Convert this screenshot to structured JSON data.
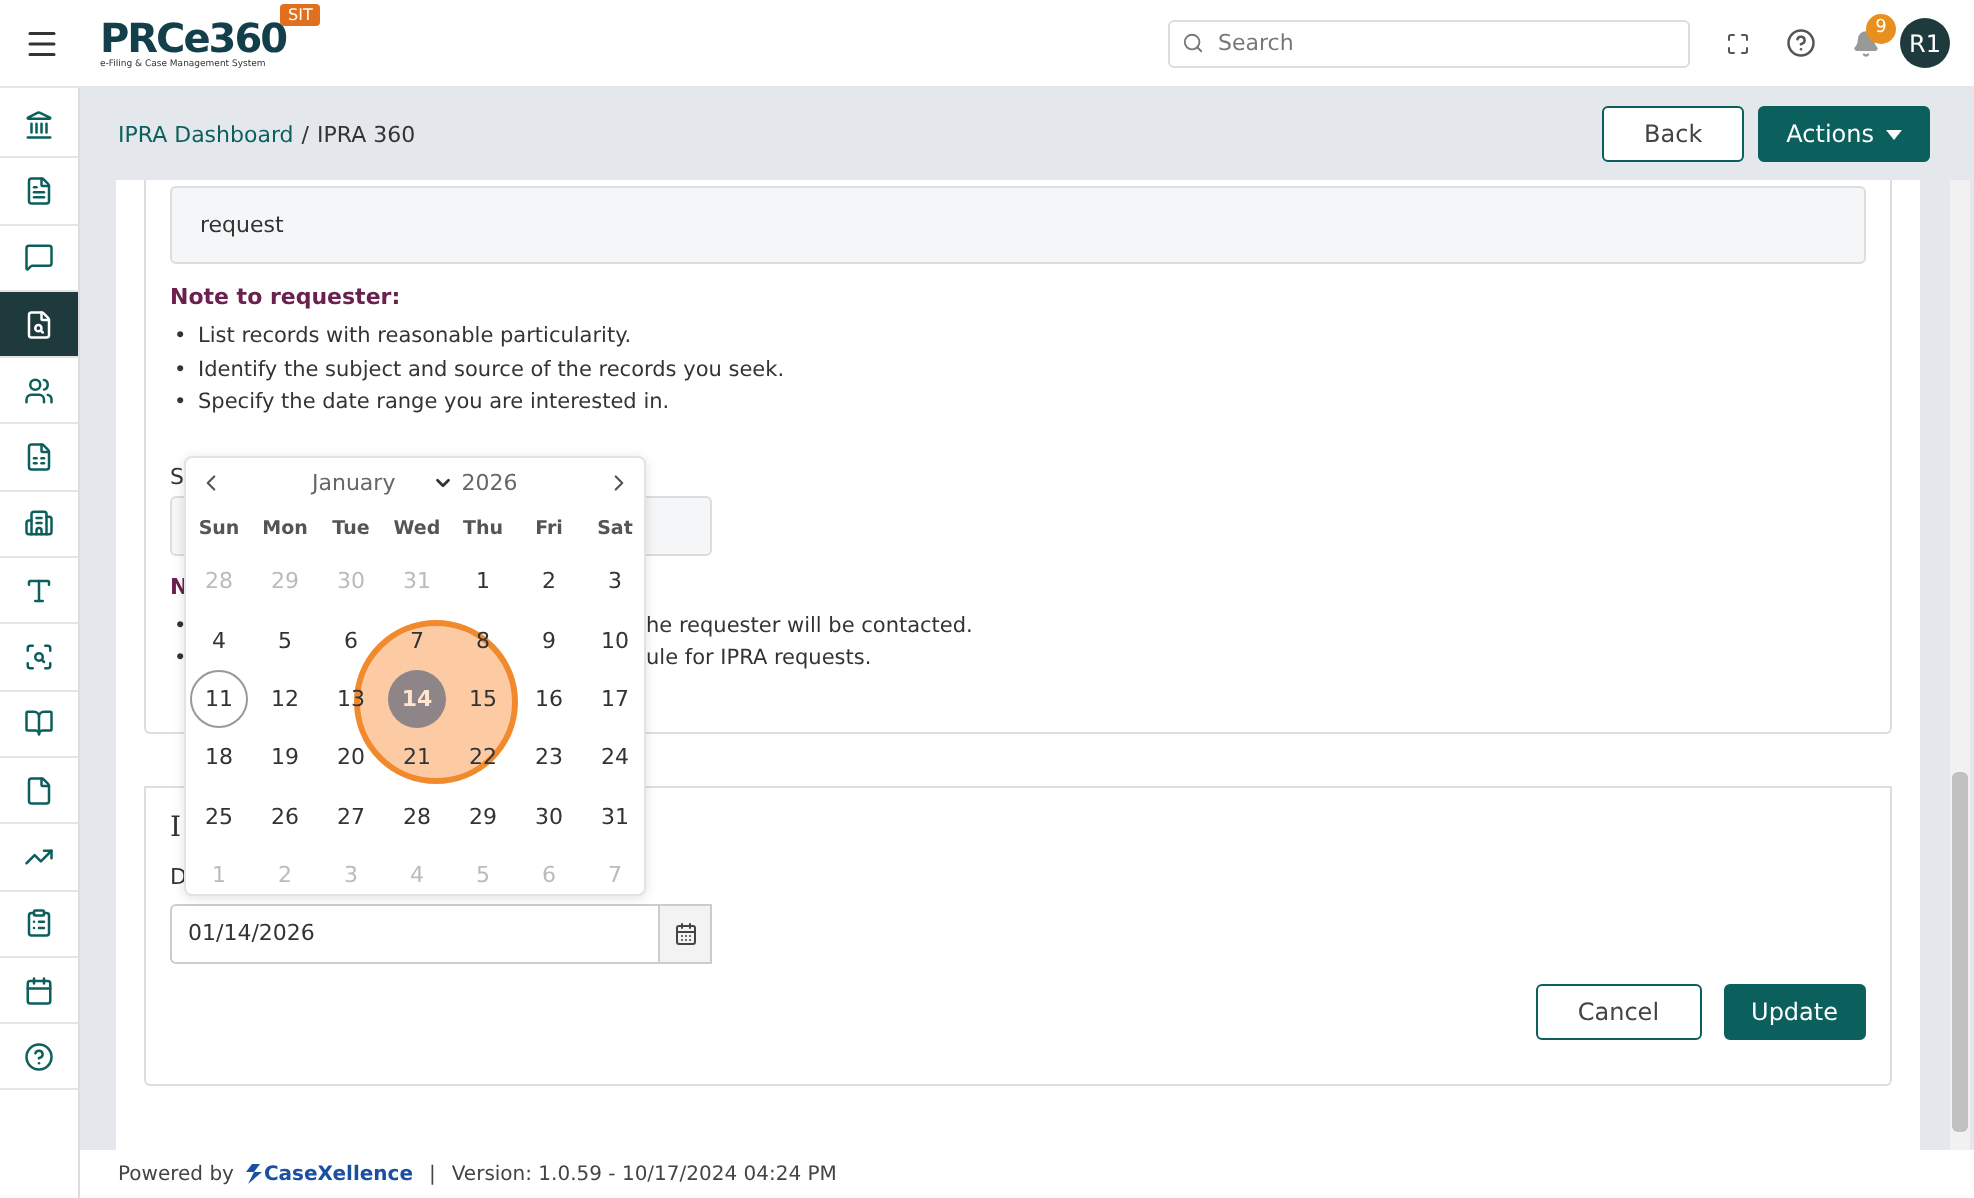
{
  "topbar": {
    "logo": "PRCe360",
    "logo_tagline": "e-Filing & Case Management System",
    "env_badge": "SIT",
    "search": {
      "placeholder": "Search"
    },
    "notification_count": "9",
    "avatar": "R1"
  },
  "sidebar": {
    "items": [
      {
        "selected": false
      },
      {
        "selected": false
      },
      {
        "selected": false
      },
      {
        "selected": true
      },
      {
        "selected": false
      },
      {
        "selected": false
      },
      {
        "selected": false
      },
      {
        "selected": false
      },
      {
        "selected": false
      },
      {
        "selected": false
      },
      {
        "selected": false
      },
      {
        "selected": false
      },
      {
        "selected": false
      },
      {
        "selected": false
      },
      {
        "selected": false
      }
    ]
  },
  "header": {
    "breadcrumb": [
      {
        "label": "IPRA Dashboard",
        "link": true
      },
      {
        "label": "/",
        "link": false
      },
      {
        "label": "IPRA 360",
        "link": false
      }
    ],
    "buttons": [
      {
        "label": "Back",
        "kind": "outline"
      },
      {
        "label": "Actions",
        "kind": "dropdown"
      }
    ]
  },
  "request_card": {
    "request_value": "request",
    "note_heading": "Note to requester:",
    "notes": [
      {
        "marker": "•",
        "text": "List records with reasonable particularity."
      },
      {
        "marker": "•",
        "text": "Identify the subject and source of the records you seek."
      },
      {
        "marker": "•",
        "text": "Specify the date range you are interested in."
      }
    ],
    "covered_label": "S",
    "covered_heading": "N",
    "covered_notes": [
      {
        "marker": "•",
        "text": "he requester will be contacted."
      },
      {
        "marker": "•",
        "text": "ule for IPRA requests."
      }
    ]
  },
  "date_card": {
    "covered_heading": "I",
    "covered_label": "D",
    "date_value": "01/14/2026",
    "buttons": [
      {
        "label": "Cancel",
        "kind": "outline"
      },
      {
        "label": "Update",
        "kind": "primary"
      }
    ]
  },
  "datepicker": {
    "month": "January",
    "year": "2026",
    "weekdays": [
      "Sun",
      "Mon",
      "Tue",
      "Wed",
      "Thu",
      "Fri",
      "Sat"
    ],
    "days": [
      {
        "label": "28",
        "muted": true,
        "selected": false,
        "today": false
      },
      {
        "label": "29",
        "muted": true,
        "selected": false,
        "today": false
      },
      {
        "label": "30",
        "muted": true,
        "selected": false,
        "today": false
      },
      {
        "label": "31",
        "muted": true,
        "selected": false,
        "today": false
      },
      {
        "label": "1",
        "muted": false,
        "selected": false,
        "today": false
      },
      {
        "label": "2",
        "muted": false,
        "selected": false,
        "today": false
      },
      {
        "label": "3",
        "muted": false,
        "selected": false,
        "today": false
      },
      {
        "label": "4",
        "muted": false,
        "selected": false,
        "today": false
      },
      {
        "label": "5",
        "muted": false,
        "selected": false,
        "today": false
      },
      {
        "label": "6",
        "muted": false,
        "selected": false,
        "today": false
      },
      {
        "label": "7",
        "muted": false,
        "selected": false,
        "today": false
      },
      {
        "label": "8",
        "muted": false,
        "selected": false,
        "today": false
      },
      {
        "label": "9",
        "muted": false,
        "selected": false,
        "today": false
      },
      {
        "label": "10",
        "muted": false,
        "selected": false,
        "today": false
      },
      {
        "label": "11",
        "muted": false,
        "selected": false,
        "today": true
      },
      {
        "label": "12",
        "muted": false,
        "selected": false,
        "today": false
      },
      {
        "label": "13",
        "muted": false,
        "selected": false,
        "today": false
      },
      {
        "label": "14",
        "muted": false,
        "selected": true,
        "today": false
      },
      {
        "label": "15",
        "muted": false,
        "selected": false,
        "today": false
      },
      {
        "label": "16",
        "muted": false,
        "selected": false,
        "today": false
      },
      {
        "label": "17",
        "muted": false,
        "selected": false,
        "today": false
      },
      {
        "label": "18",
        "muted": false,
        "selected": false,
        "today": false
      },
      {
        "label": "19",
        "muted": false,
        "selected": false,
        "today": false
      },
      {
        "label": "20",
        "muted": false,
        "selected": false,
        "today": false
      },
      {
        "label": "21",
        "muted": false,
        "selected": false,
        "today": false
      },
      {
        "label": "22",
        "muted": false,
        "selected": false,
        "today": false
      },
      {
        "label": "23",
        "muted": false,
        "selected": false,
        "today": false
      },
      {
        "label": "24",
        "muted": false,
        "selected": false,
        "today": false
      },
      {
        "label": "25",
        "muted": false,
        "selected": false,
        "today": false
      },
      {
        "label": "26",
        "muted": false,
        "selected": false,
        "today": false
      },
      {
        "label": "27",
        "muted": false,
        "selected": false,
        "today": false
      },
      {
        "label": "28",
        "muted": false,
        "selected": false,
        "today": false
      },
      {
        "label": "29",
        "muted": false,
        "selected": false,
        "today": false
      },
      {
        "label": "30",
        "muted": false,
        "selected": false,
        "today": false
      },
      {
        "label": "31",
        "muted": false,
        "selected": false,
        "today": false
      },
      {
        "label": "1",
        "muted": true,
        "selected": false,
        "today": false
      },
      {
        "label": "2",
        "muted": true,
        "selected": false,
        "today": false
      },
      {
        "label": "3",
        "muted": true,
        "selected": false,
        "today": false
      },
      {
        "label": "4",
        "muted": true,
        "selected": false,
        "today": false
      },
      {
        "label": "5",
        "muted": true,
        "selected": false,
        "today": false
      },
      {
        "label": "6",
        "muted": true,
        "selected": false,
        "today": false
      },
      {
        "label": "7",
        "muted": true,
        "selected": false,
        "today": false
      }
    ]
  },
  "footer": {
    "powered_by": "Powered by",
    "brand": "CaseXellence",
    "separator": "|",
    "version": "Version: 1.0.59 - 10/17/2024 04:24 PM"
  }
}
